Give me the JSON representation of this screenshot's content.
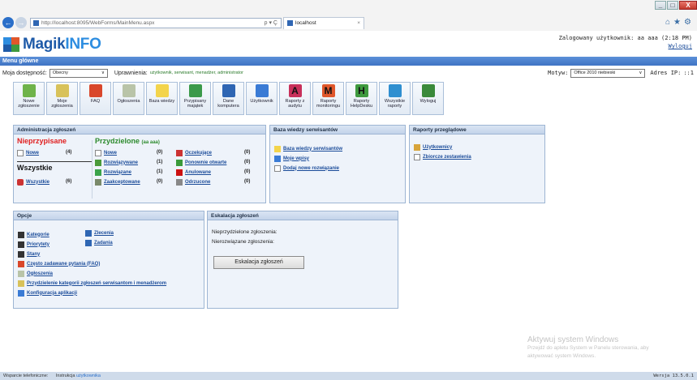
{
  "browser": {
    "url": "http://localhost:8095/WebForms/MainMenu.aspx",
    "url_host_bold": "localhost",
    "tab_title": "localhost",
    "search_glyph": "ρ ▾ Ç"
  },
  "app": {
    "logo_part1": "Magik",
    "logo_part2": "INFO",
    "user_label": "Zalogowany użytkownik: aa aaa (2:18 PM)",
    "logout": "Wyloguj",
    "menu_title": "Menu główne"
  },
  "filters": {
    "availability_label": "Moja dostępność:",
    "availability_value": "Obecny",
    "permissions_label": "Uprawnienia:",
    "permissions_value": "użytkownik, serwisant, menadżer, administrator",
    "theme_label": "Motyw:",
    "theme_value": "Office 2010 niebieski",
    "ip_label": "Adres IP:",
    "ip_value": "::1"
  },
  "toolbar": [
    {
      "label": "Nowe zgłoszenie",
      "icon": "new-ticket-icon",
      "color": "#6fb34a"
    },
    {
      "label": "Moje zgłoszenia",
      "icon": "my-tickets-icon",
      "color": "#d8c25a"
    },
    {
      "label": "FAQ",
      "icon": "lifebuoy-icon",
      "color": "#d9472b"
    },
    {
      "label": "Ogłoszenia",
      "icon": "announcements-icon",
      "color": "#b9c4a8"
    },
    {
      "label": "Baza wiedzy",
      "icon": "lightbulb-icon",
      "color": "#f3d44b"
    },
    {
      "label": "Przypisany majątek",
      "icon": "assets-icon",
      "color": "#3b9a4a"
    },
    {
      "label": "Dane komputera",
      "icon": "computer-icon",
      "color": "#2f66b3"
    },
    {
      "label": "Użytkownik",
      "icon": "user-icon",
      "color": "#3a7bd5"
    },
    {
      "label": "Raporty z audytu",
      "icon": "report-a-icon",
      "color": "#c8305a",
      "letter": "A"
    },
    {
      "label": "Raporty monitoringu",
      "icon": "report-m-icon",
      "color": "#e0572b",
      "letter": "M"
    },
    {
      "label": "Raporty HelpDesku",
      "icon": "report-h-icon",
      "color": "#3e9a3e",
      "letter": "H"
    },
    {
      "label": "Wszystkie raporty",
      "icon": "all-reports-icon",
      "color": "#2f8fd0"
    },
    {
      "label": "Wyloguj",
      "icon": "logout-icon",
      "color": "#3a8a3a"
    }
  ],
  "admin": {
    "title": "Administracja zgłoszeń",
    "unassigned_title": "Nieprzypisane",
    "unassigned_new": "Nowe",
    "unassigned_new_count": "(4)",
    "all_title": "Wszystkie",
    "all_link": "Wszystkie",
    "all_count": "(6)",
    "assigned_title": "Przydzielone",
    "assigned_user": "(aa aaa)",
    "col1": [
      {
        "label": "Nowe",
        "count": "(0)",
        "icon": "new-icon"
      },
      {
        "label": "Rozwiązywane",
        "count": "(1)",
        "icon": "in-progress-icon"
      },
      {
        "label": "Rozwiązane",
        "count": "(1)",
        "icon": "resolved-icon"
      },
      {
        "label": "Zaakceptowane",
        "count": "(0)",
        "icon": "accepted-icon"
      }
    ],
    "col2": [
      {
        "label": "Oczekujące",
        "count": "(0)",
        "icon": "pending-icon"
      },
      {
        "label": "Ponownie otwarte",
        "count": "(0)",
        "icon": "reopened-icon"
      },
      {
        "label": "Anulowane",
        "count": "(0)",
        "icon": "cancelled-icon"
      },
      {
        "label": "Odrzucone",
        "count": "(0)",
        "icon": "rejected-icon"
      }
    ]
  },
  "knowledge": {
    "title": "Baza wiedzy serwisantów",
    "items": [
      "Baza wiedzy serwisantów",
      "Moje wpisy",
      "Dodaj nowe rozwiązanie"
    ]
  },
  "reports": {
    "title": "Raporty przeglądowe",
    "items": [
      "Użytkownicy",
      "Zbiorcze zestawienia"
    ]
  },
  "options": {
    "title": "Opcje",
    "left": [
      "Kategorie",
      "Priorytety",
      "Stany",
      "Często zadawane pytania (FAQ)",
      "Ogłoszenia",
      "Przydzielenie kategorii zgłoszeń serwisantom i menadżerom",
      "Konfiguracja aplikacji"
    ],
    "right": [
      "Zlecenia",
      "Zadania"
    ]
  },
  "escalation": {
    "title": "Eskalacja zgłoszeń",
    "line1": "Nieprzydzielone zgłoszenia:",
    "line2": "Nierozwiązane zgłoszenia:",
    "button": "Eskalacja zgłoszeń"
  },
  "watermark": {
    "line1": "Aktywuj system Windows",
    "line2": "Przejdź do apletu System w Panelu sterowania, aby",
    "line3": "aktywować system Windows."
  },
  "footer": {
    "phone_label": "Wsparcie telefoniczne:",
    "manual_label": "Instrukcja",
    "manual_link": "użytkownika",
    "version": "Wersja 13.5.0.1"
  }
}
